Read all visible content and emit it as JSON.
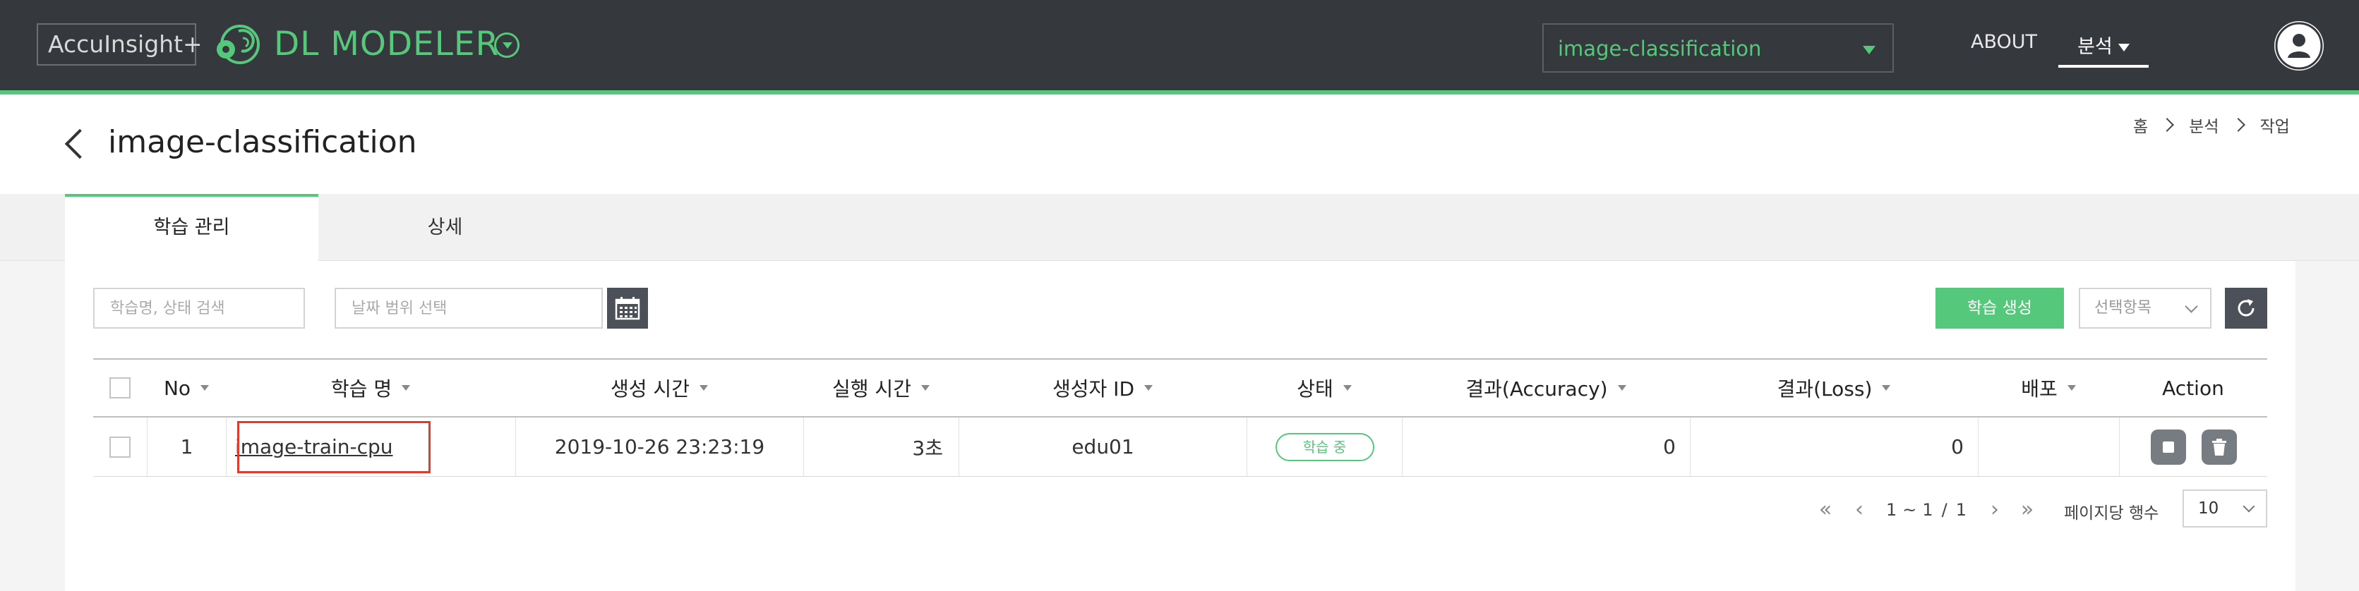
{
  "topbar": {
    "brand": "AccuInsight+",
    "product": "DL MODELER",
    "project_select": "image-classification",
    "nav_about": "ABOUT",
    "nav_menu": "분석"
  },
  "header": {
    "title": "image-classification",
    "breadcrumb": [
      "홈",
      "분석",
      "작업"
    ]
  },
  "tabs": [
    "학습 관리",
    "상세"
  ],
  "toolbar": {
    "search_placeholder": "학습명, 상태 검색",
    "date_placeholder": "날짜 범위 선택",
    "create_label": "학습 생성",
    "select_label": "선택항목"
  },
  "table": {
    "columns": [
      "No",
      "학습 명",
      "생성 시간",
      "실행 시간",
      "생성자 ID",
      "상태",
      "결과(Accuracy)",
      "결과(Loss)",
      "배포",
      "Action"
    ],
    "rows": [
      {
        "no": "1",
        "name": "image-train-cpu",
        "created": "2019-10-26 23:23:19",
        "runtime": "3초",
        "creator": "edu01",
        "status": "학습 중",
        "accuracy": "0",
        "loss": "0",
        "deploy": ""
      }
    ]
  },
  "pagination": {
    "current": "1",
    "sep": "~",
    "end": "1",
    "slash": "/",
    "total": "1",
    "rows_label": "페이지당 행수",
    "rows_value": "10"
  },
  "colors": {
    "accent": "#56c87b",
    "topbar": "#35383d",
    "highlight": "#e03c2c"
  }
}
